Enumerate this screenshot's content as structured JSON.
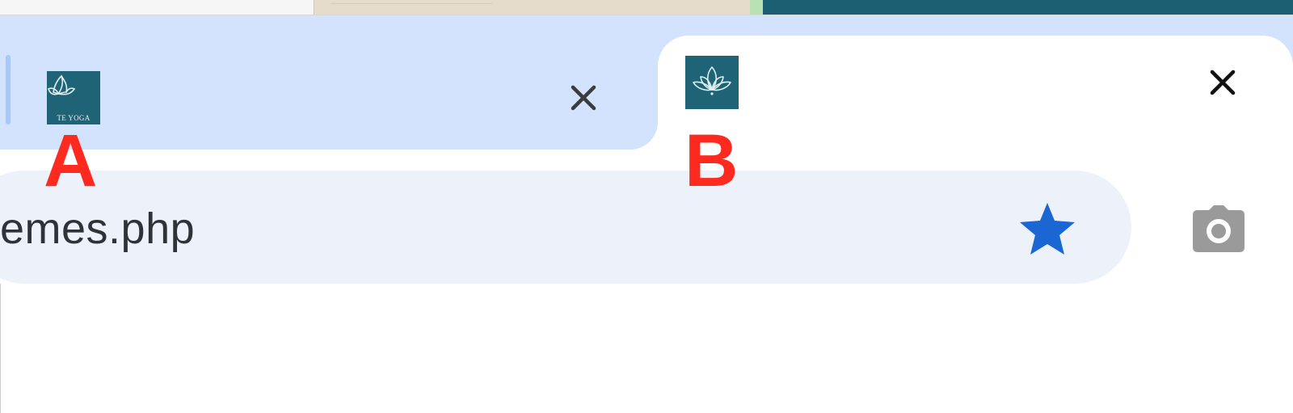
{
  "browser": {
    "tabs": [
      {
        "favicon": "lotus-yoga-logo",
        "favicon_text": "TE YOGA",
        "title": "",
        "close_icon": "close-icon",
        "state": "inactive"
      },
      {
        "favicon": "lotus-yoga-logo",
        "favicon_text": "",
        "title": "",
        "close_icon": "close-icon",
        "state": "active"
      }
    ],
    "omnibox": {
      "url_text": "emes.php",
      "bookmark_icon": "star-icon"
    },
    "toolbar": {
      "screenshot_icon": "camera-icon"
    }
  },
  "annotations": {
    "a": "A",
    "b": "B"
  },
  "colors": {
    "tab_strip": "#d3e3fd",
    "active_tab": "#ffffff",
    "omnibox": "#ecf1fa",
    "favicon_bg": "#1e6476",
    "bookmark_star": "#1a66d2",
    "annotation_red": "#ff2a1f",
    "camera_gray": "#9a9a9a"
  }
}
